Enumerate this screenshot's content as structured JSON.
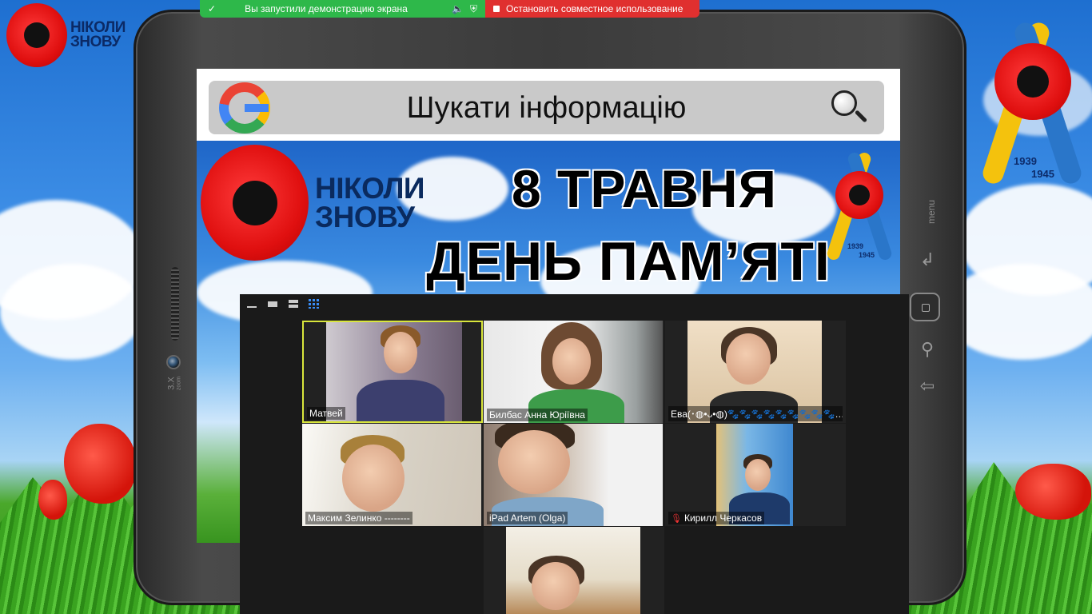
{
  "share_bar": {
    "status_text": "Вы запустили демонстрацию экрана",
    "stop_label": "Остановить совместное использование"
  },
  "logo": {
    "line1": "НІКОЛИ",
    "line2": "ЗНОВУ"
  },
  "ribbon": {
    "year_start": "1939",
    "year_end": "1945"
  },
  "screen": {
    "search_text": "Шукати інформацію",
    "banner_line1": "8 ТРАВНЯ",
    "banner_line2": "ДЕНЬ ПАМ’ЯТІ"
  },
  "tablet": {
    "zoom_label": "3.X",
    "zoom_small": "zoom",
    "menu_label": "menu"
  },
  "gallery": {
    "participants": [
      {
        "name": "Матвей",
        "active": true
      },
      {
        "name": "Билбас Анна Юріївна",
        "active": false
      },
      {
        "name": "Ева(･◍•ᴗ•◍)🐾🐾🐾🐾🐾🐾🐾🐾🐾…",
        "active": false
      },
      {
        "name": "Максим Зелинко --------",
        "active": false
      },
      {
        "name": "iPad Artem (Olga)",
        "active": false
      },
      {
        "name": "Кирилл Черкасов",
        "active": false,
        "muted": true
      },
      {
        "name": "",
        "active": false
      }
    ]
  },
  "colors": {
    "share_green": "#2eb84a",
    "share_red": "#e0302f",
    "active_border": "#d9e63c",
    "poppy_red": "#e01010"
  }
}
